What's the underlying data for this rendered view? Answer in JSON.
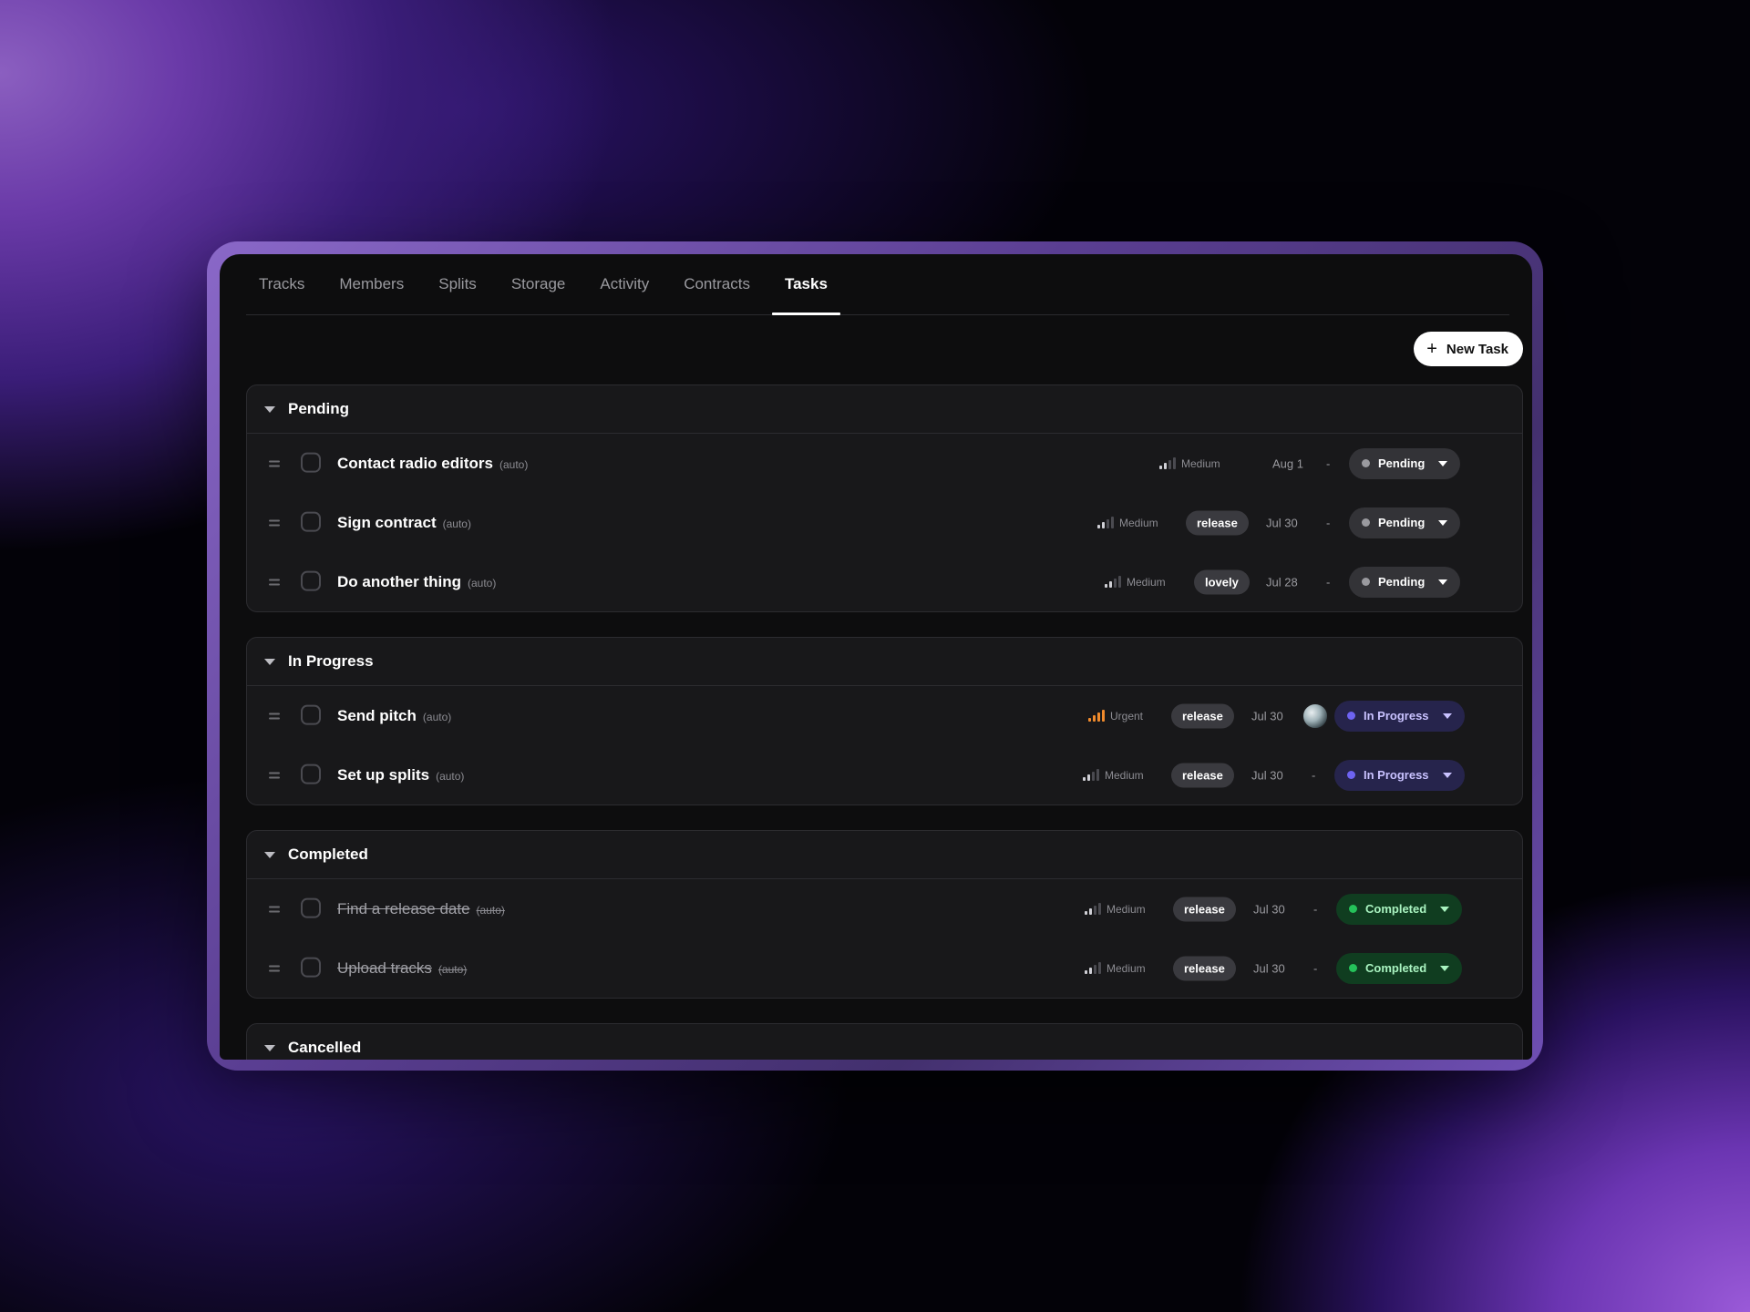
{
  "tabs": [
    "Tracks",
    "Members",
    "Splits",
    "Storage",
    "Activity",
    "Contracts",
    "Tasks"
  ],
  "active_tab": "Tasks",
  "new_task_label": "New Task",
  "groups": [
    {
      "title": "Pending",
      "tasks": [
        {
          "title": "Contact radio editors",
          "auto": "(auto)",
          "priority": "Medium",
          "tag": "",
          "date": "Aug 1",
          "assignee": "-",
          "status": "Pending"
        },
        {
          "title": "Sign contract",
          "auto": "(auto)",
          "priority": "Medium",
          "tag": "release",
          "date": "Jul 30",
          "assignee": "-",
          "status": "Pending"
        },
        {
          "title": "Do another thing",
          "auto": "(auto)",
          "priority": "Medium",
          "tag": "lovely",
          "date": "Jul 28",
          "assignee": "-",
          "status": "Pending"
        }
      ]
    },
    {
      "title": "In Progress",
      "tasks": [
        {
          "title": "Send pitch",
          "auto": "(auto)",
          "priority": "Urgent",
          "tag": "release",
          "date": "Jul 30",
          "assignee": "avatar",
          "status": "In Progress"
        },
        {
          "title": "Set up splits",
          "auto": "(auto)",
          "priority": "Medium",
          "tag": "release",
          "date": "Jul 30",
          "assignee": "-",
          "status": "In Progress"
        }
      ]
    },
    {
      "title": "Completed",
      "tasks": [
        {
          "title": "Find a release date",
          "auto": "(auto)",
          "priority": "Medium",
          "tag": "release",
          "date": "Jul 30",
          "assignee": "-",
          "status": "Completed"
        },
        {
          "title": "Upload tracks",
          "auto": "(auto)",
          "priority": "Medium",
          "tag": "release",
          "date": "Jul 30",
          "assignee": "-",
          "status": "Completed"
        }
      ]
    },
    {
      "title": "Cancelled",
      "tasks": []
    }
  ],
  "colors": {
    "pending": "#9a9a9f",
    "in_progress": "#6e63f2",
    "completed": "#25c25a",
    "urgent": "#f08a2c"
  }
}
